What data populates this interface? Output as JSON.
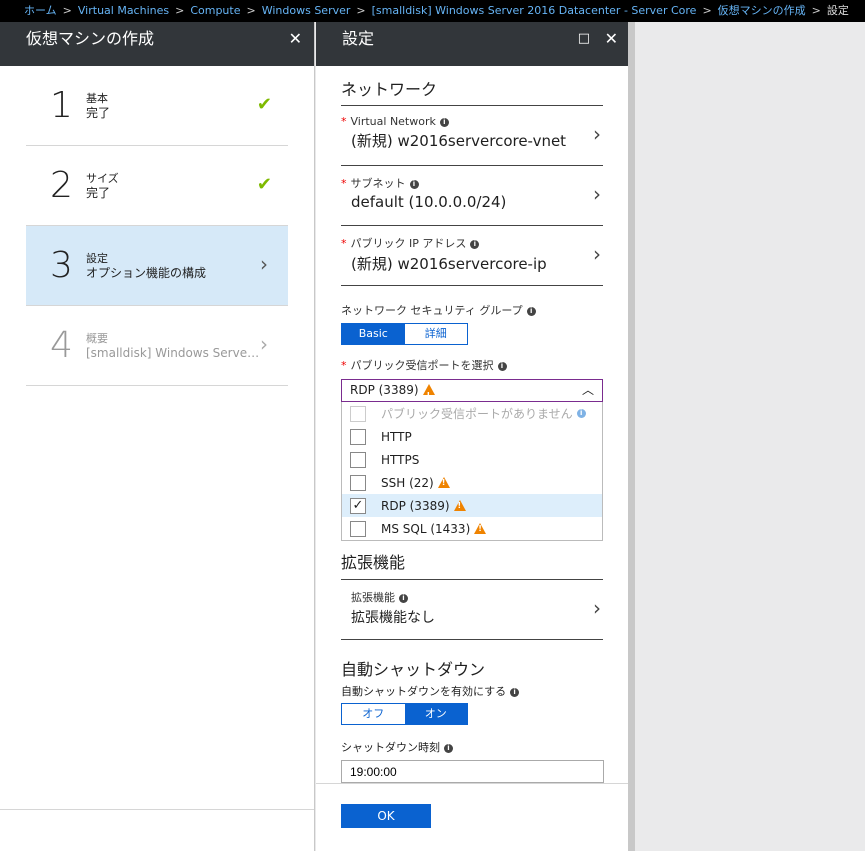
{
  "breadcrumb": {
    "items": [
      "ホーム",
      "Virtual Machines",
      "Compute",
      "Windows Server",
      "[smalldisk] Windows Server 2016 Datacenter - Server Core",
      "仮想マシンの作成"
    ],
    "current": "設定"
  },
  "blade1": {
    "title": "仮想マシンの作成",
    "close_icon": "✕",
    "steps": [
      {
        "num": "1",
        "title": "基本",
        "subtitle": "完了",
        "status": "check"
      },
      {
        "num": "2",
        "title": "サイズ",
        "subtitle": "完了",
        "status": "check"
      },
      {
        "num": "3",
        "title": "設定",
        "subtitle": "オプション機能の構成",
        "status": "active"
      },
      {
        "num": "4",
        "title": "概要",
        "subtitle": "[smalldisk] Windows Serve…",
        "status": "disabled"
      }
    ]
  },
  "blade2": {
    "title": "設定",
    "maximize_icon": "□",
    "close_icon": "✕",
    "network": {
      "section_title": "ネットワーク",
      "vnet_label": "Virtual Network",
      "vnet_value": "(新規) w2016servercore-vnet",
      "subnet_label": "サブネット",
      "subnet_value": "default (10.0.0.0/24)",
      "pip_label": "パブリック IP アドレス",
      "pip_value": "(新規) w2016servercore-ip",
      "nsg_label": "ネットワーク セキュリティ グループ",
      "nsg_basic": "Basic",
      "nsg_advanced": "詳細",
      "ports_label": "パブリック受信ポートを選択",
      "ports_selected": "RDP (3389)",
      "ports_options": [
        {
          "label": "パブリック受信ポートがありません",
          "checked": false,
          "disabled": true,
          "warn": false,
          "info": true
        },
        {
          "label": "HTTP",
          "checked": false,
          "disabled": false,
          "warn": false,
          "info": false
        },
        {
          "label": "HTTPS",
          "checked": false,
          "disabled": false,
          "warn": false,
          "info": false
        },
        {
          "label": "SSH (22)",
          "checked": false,
          "disabled": false,
          "warn": true,
          "info": false
        },
        {
          "label": "RDP (3389)",
          "checked": true,
          "disabled": false,
          "warn": true,
          "info": false
        },
        {
          "label": "MS SQL (1433)",
          "checked": false,
          "disabled": false,
          "warn": true,
          "info": false
        }
      ]
    },
    "extensions": {
      "section_title": "拡張機能",
      "label": "拡張機能",
      "value": "拡張機能なし"
    },
    "shutdown": {
      "section_title": "自動シャットダウン",
      "enable_label": "自動シャットダウンを有効にする",
      "off": "オフ",
      "on": "オン",
      "time_label": "シャットダウン時刻",
      "time_value": "19:00:00"
    },
    "ok_label": "OK"
  }
}
